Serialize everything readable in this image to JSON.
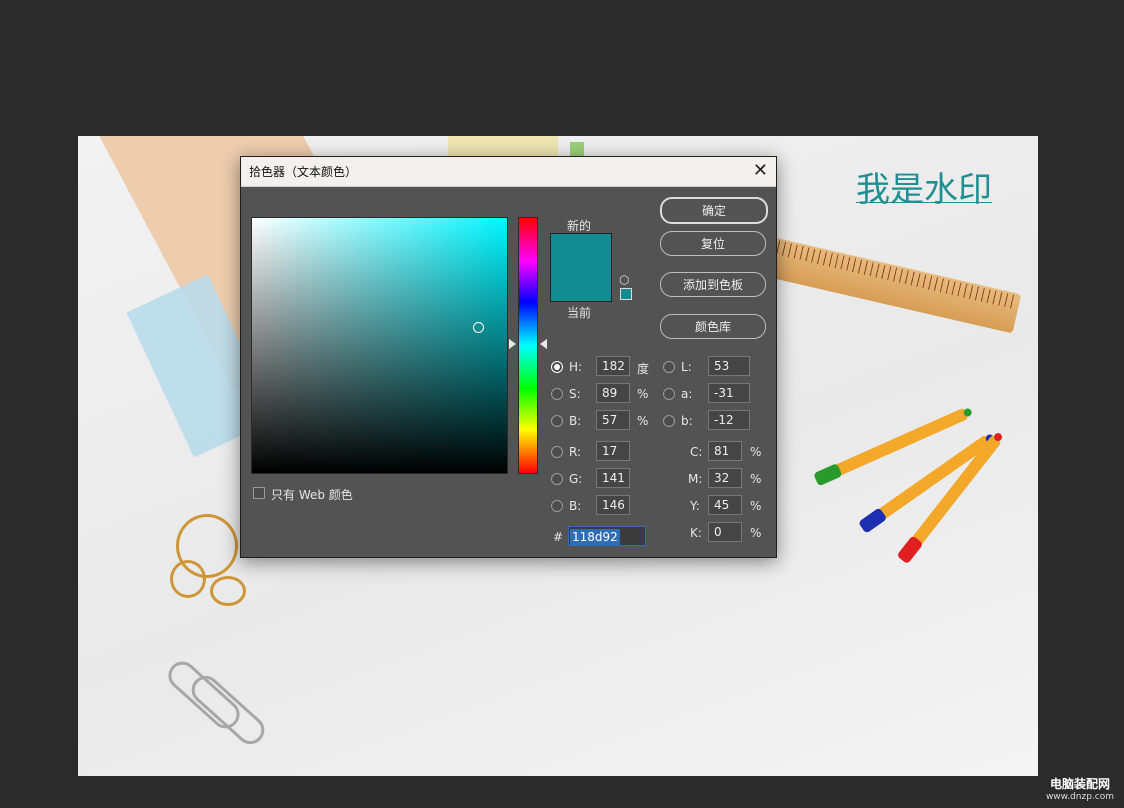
{
  "background_text": {
    "watermark": "我是水印"
  },
  "dialog": {
    "title": "拾色器（文本颜色）",
    "close_glyph": "✕",
    "labels": {
      "new": "新的",
      "current": "当前"
    },
    "colors": {
      "new_color": "#118d92",
      "current_color": "#118d92",
      "hue_pure": "#00f6ff"
    },
    "buttons": {
      "ok": "确定",
      "reset": "复位",
      "add_to_swatches": "添加到色板",
      "color_libraries": "颜色库"
    },
    "only_web_colors": "只有 Web 颜色",
    "fields": {
      "H": {
        "label": "H:",
        "value": "182",
        "unit": "度"
      },
      "S": {
        "label": "S:",
        "value": "89",
        "unit": "%"
      },
      "Bv": {
        "label": "B:",
        "value": "57",
        "unit": "%"
      },
      "R": {
        "label": "R:",
        "value": "17"
      },
      "G": {
        "label": "G:",
        "value": "141"
      },
      "Bb": {
        "label": "B:",
        "value": "146"
      },
      "L": {
        "label": "L:",
        "value": "53"
      },
      "a": {
        "label": "a:",
        "value": "-31"
      },
      "b": {
        "label": "b:",
        "value": "-12"
      },
      "C": {
        "label": "C:",
        "value": "81",
        "unit": "%"
      },
      "M": {
        "label": "M:",
        "value": "32",
        "unit": "%"
      },
      "Y": {
        "label": "Y:",
        "value": "45",
        "unit": "%"
      },
      "K": {
        "label": "K:",
        "value": "0",
        "unit": "%"
      }
    },
    "hex": {
      "label": "#",
      "value": "118d92"
    },
    "selected_mode": "H"
  },
  "site_brand": {
    "name": "电脑装配网",
    "url": "www.dnzp.com"
  }
}
